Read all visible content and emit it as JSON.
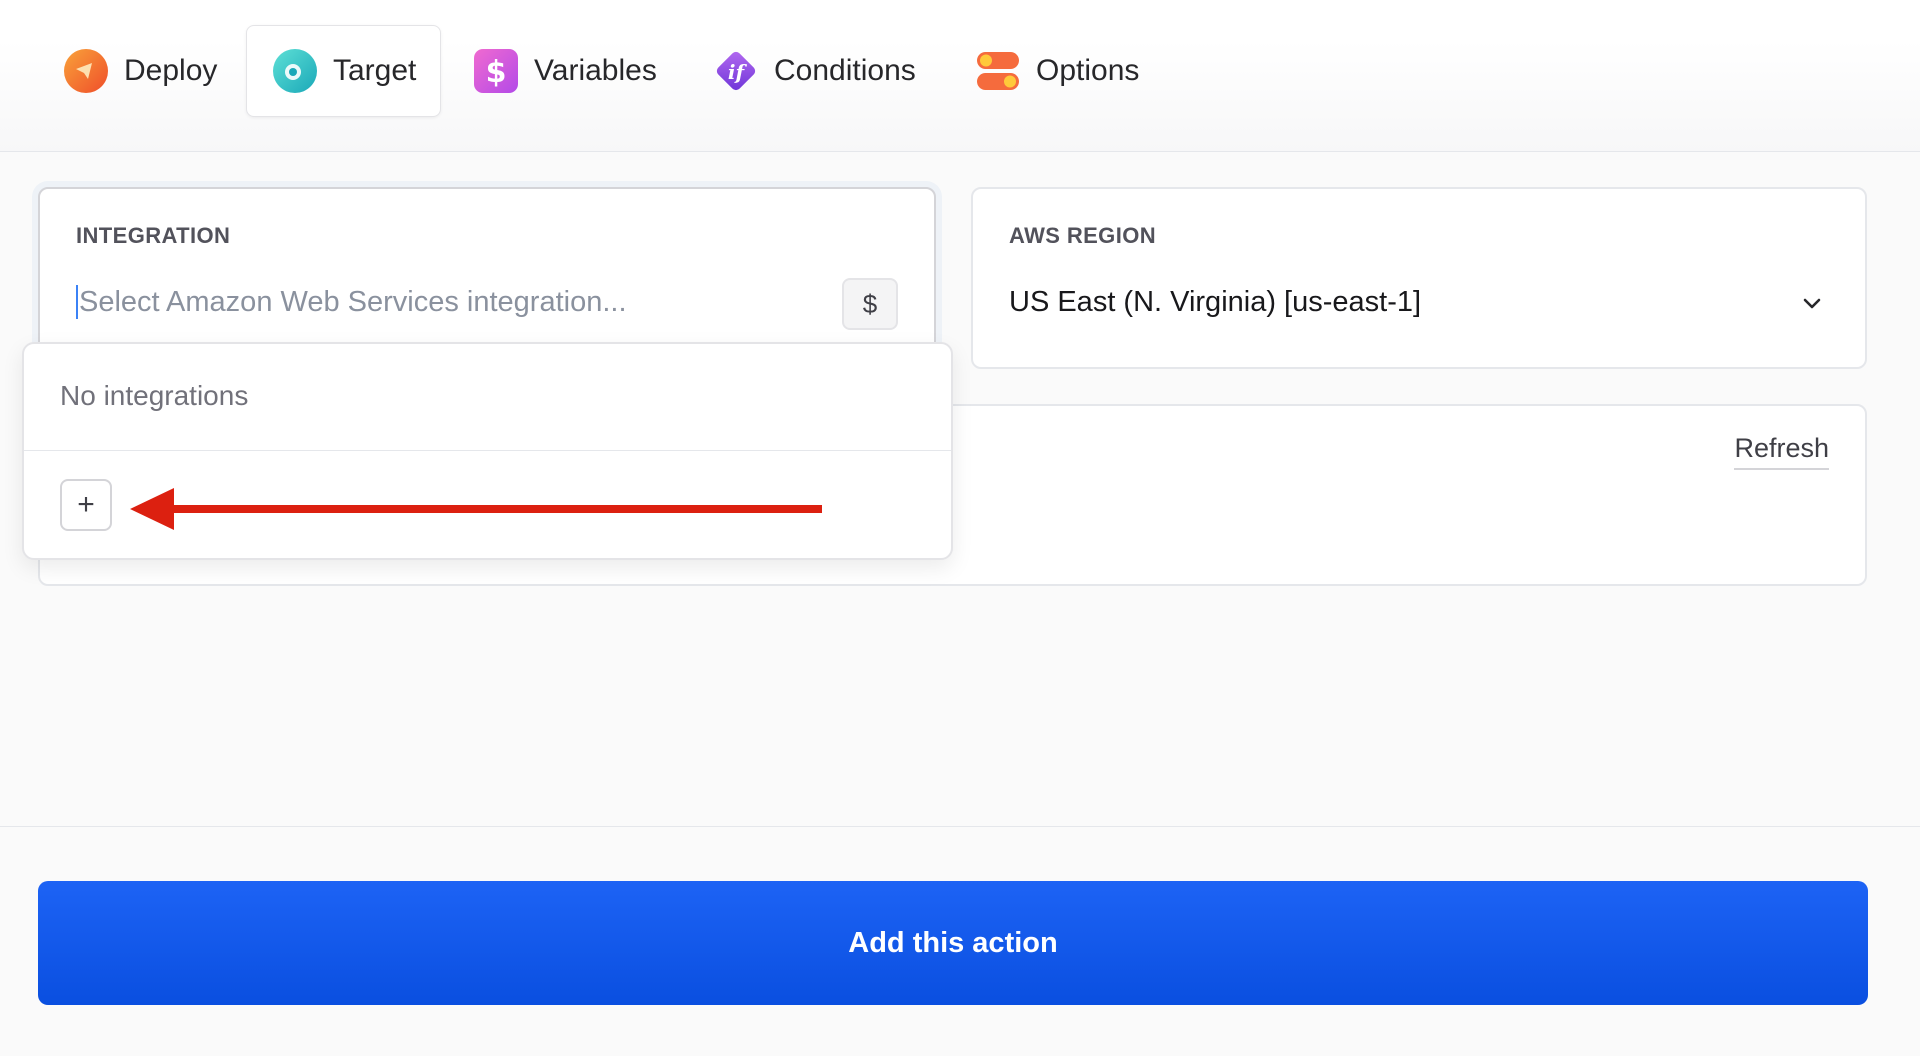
{
  "tabs": [
    {
      "label": "Deploy",
      "icon": "deploy-icon",
      "active": false
    },
    {
      "label": "Target",
      "icon": "target-icon",
      "active": true
    },
    {
      "label": "Variables",
      "icon": "variables-icon",
      "active": false
    },
    {
      "label": "Conditions",
      "icon": "conditions-icon",
      "active": false
    },
    {
      "label": "Options",
      "icon": "options-icon",
      "active": false
    }
  ],
  "integration": {
    "label": "INTEGRATION",
    "placeholder": "Select Amazon Web Services integration...",
    "variable_button": "$"
  },
  "aws_region": {
    "label": "AWS REGION",
    "value": "US East (N. Virginia) [us-east-1]"
  },
  "lower_card": {
    "refresh_label": "Refresh"
  },
  "dropdown": {
    "empty_text": "No integrations",
    "add_button": "+"
  },
  "footer": {
    "primary_button": "Add this action"
  },
  "colors": {
    "primary": "#1d63f5",
    "annotation_arrow": "#dc2010"
  }
}
